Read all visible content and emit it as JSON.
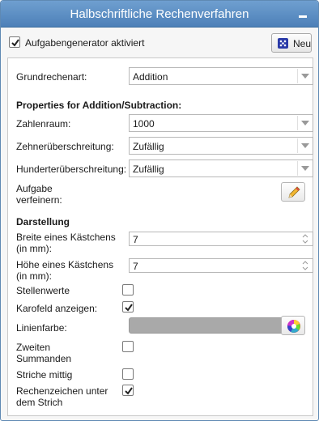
{
  "window": {
    "title": "Halbschriftliche Rechenverfahren"
  },
  "generator": {
    "label": "Aufgabengenerator aktiviert",
    "checked": true,
    "new_button": "Neu"
  },
  "grundrechenart": {
    "label": "Grundrechenart:",
    "value": "Addition"
  },
  "properties_heading": "Properties for Addition/Subtraction:",
  "zahlenraum": {
    "label": "Zahlenraum:",
    "value": "1000"
  },
  "zehner": {
    "label": "Zehnerüberschreitung:",
    "value": "Zufällig"
  },
  "hunderter": {
    "label": "Hunderterüberschreitung:",
    "value": "Zufällig"
  },
  "verfeinern": {
    "label": "Aufgabe verfeinern:"
  },
  "darstellung_heading": "Darstellung",
  "breite": {
    "label": "Breite eines Kästchens (in mm):",
    "value": "7"
  },
  "hoehe": {
    "label": "Höhe eines Kästchens (in mm):",
    "value": "7"
  },
  "stellenwerte": {
    "label": "Stellenwerte",
    "checked": false
  },
  "karofeld": {
    "label": "Karofeld anzeigen:",
    "checked": true
  },
  "linienfarbe": {
    "label": "Linienfarbe:",
    "color": "#a9a9a9"
  },
  "zweiten": {
    "label": "Zweiten Summanden",
    "checked": false
  },
  "striche": {
    "label": "Striche mittig",
    "checked": false
  },
  "rechenzeichen": {
    "label": "Rechenzeichen unter dem Strich",
    "checked": true
  },
  "colors": {
    "title_bar": "#5a8cc4",
    "accent_border": "#5f89b3"
  }
}
